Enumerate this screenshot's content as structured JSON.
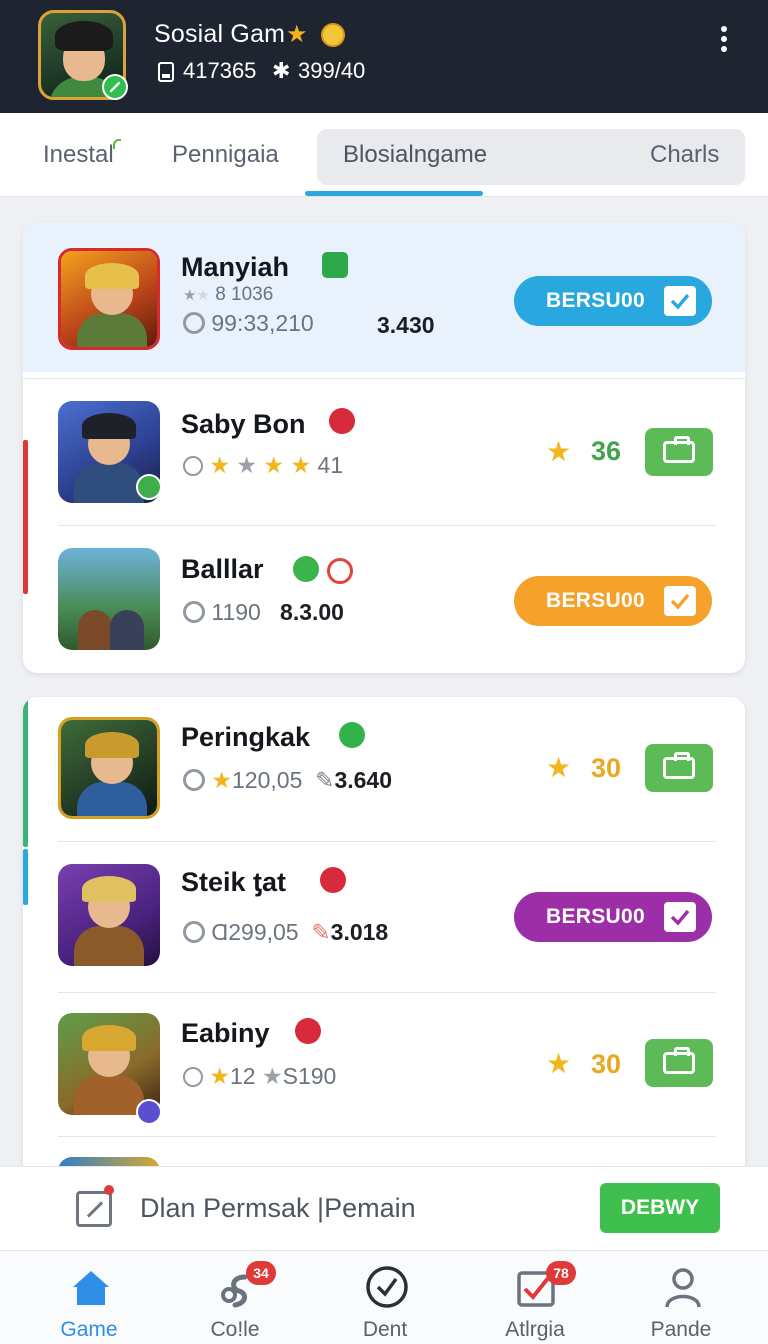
{
  "header": {
    "title": "Sosial Gam",
    "stat_primary": "417365",
    "stat_secondary": "399/40",
    "icons": [
      "avatar",
      "star-icon",
      "coin-icon",
      "card-icon",
      "gear-icon",
      "more-vert-icon"
    ]
  },
  "tabs": [
    {
      "label": "Inestal"
    },
    {
      "label": "Pennigaia"
    },
    {
      "label": "Blosialngame",
      "active": true
    },
    {
      "label": "Charls"
    }
  ],
  "games": [
    {
      "name": "Manyiah",
      "meta_count": "8 1036",
      "meta_value": "99:33,210",
      "meta_bold": "3.430",
      "action": "BERSU00",
      "action_color": "#29a8e0"
    },
    {
      "name": "Saby Bon",
      "meta_text": "41",
      "score": "36",
      "score_color": "#3fa44a"
    },
    {
      "name": "Balllar",
      "meta_value": "1190",
      "meta_bold": "8.3.00",
      "action": "BERSU00",
      "action_color": "#f6a12a"
    },
    {
      "name": "Peringkak",
      "meta_value": "120,05",
      "meta_bold": "3.640",
      "score": "30",
      "score_color": "#e7a823"
    },
    {
      "name": "Steik ƫat",
      "meta_value": "Ɑ299,05",
      "meta_bold": "3.018",
      "action": "BERSU00",
      "action_color": "#9c2fa8"
    },
    {
      "name": "Eabiny",
      "meta_value": "12",
      "meta_bold": "S190",
      "score": "30",
      "score_color": "#e7a823"
    }
  ],
  "action_bar": {
    "text": "Dlan Permsak |Pemain",
    "button": "DEBWY"
  },
  "nav": [
    {
      "label": "Game",
      "icon": "home-icon",
      "active": true
    },
    {
      "label": "Co!le",
      "icon": "link-icon",
      "badge": "34"
    },
    {
      "label": "Dent",
      "icon": "clock-icon"
    },
    {
      "label": "Atlrgia",
      "icon": "checkbox-icon",
      "badge": "78"
    },
    {
      "label": "Pande",
      "icon": "person-icon"
    }
  ],
  "colors": {
    "header_bg": "#1e2530",
    "accent_blue": "#29a8e0",
    "green": "#5cbb56",
    "orange": "#f6a12a",
    "purple": "#9c2fa8"
  }
}
